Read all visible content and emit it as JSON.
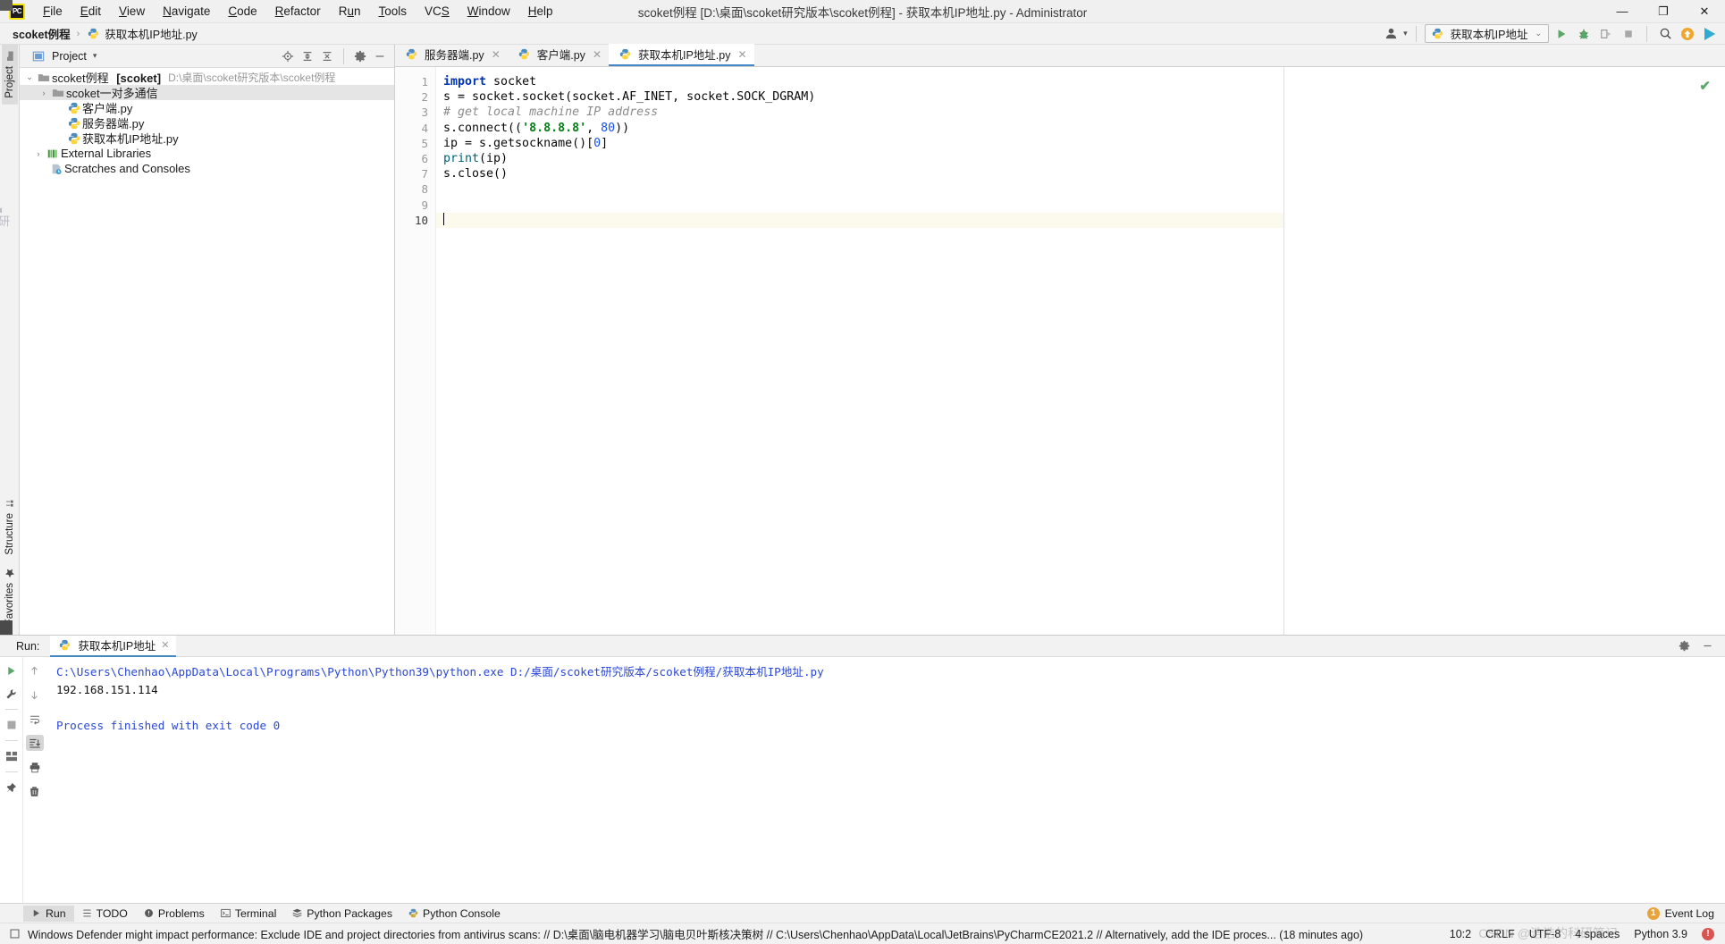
{
  "window": {
    "title": "scoket例程 [D:\\桌面\\scoket研究版本\\scoket例程] - 获取本机IP地址.py - Administrator",
    "minimize": "—",
    "maximize": "❐",
    "close": "✕"
  },
  "menu": [
    {
      "label": "File"
    },
    {
      "label": "Edit"
    },
    {
      "label": "View"
    },
    {
      "label": "Navigate"
    },
    {
      "label": "Code"
    },
    {
      "label": "Refactor"
    },
    {
      "label": "Run"
    },
    {
      "label": "Tools"
    },
    {
      "label": "VCS"
    },
    {
      "label": "Window"
    },
    {
      "label": "Help"
    }
  ],
  "breadcrumb": {
    "project": "scoket例程",
    "separator": "›",
    "file": "获取本机IP地址.py"
  },
  "toolbar": {
    "run_config": "获取本机IP地址",
    "chevron": "⌄",
    "account_caret": "▾"
  },
  "project_panel": {
    "title": "Project",
    "title_caret": "▾",
    "tree": [
      {
        "indent": 0,
        "arrow": "⌄",
        "label": "scoket例程",
        "module": "[scoket]",
        "path": "D:\\桌面\\scoket研究版本\\scoket例程",
        "icon": "folder-icon",
        "selected": false
      },
      {
        "indent": 1,
        "arrow": "›",
        "label": "scoket一对多通信",
        "module": "",
        "path": "",
        "icon": "folder-icon",
        "selected": true
      },
      {
        "indent": 2,
        "arrow": "",
        "label": "客户端.py",
        "module": "",
        "path": "",
        "icon": "python-file-icon",
        "selected": false
      },
      {
        "indent": 2,
        "arrow": "",
        "label": "服务器端.py",
        "module": "",
        "path": "",
        "icon": "python-file-icon",
        "selected": false
      },
      {
        "indent": 2,
        "arrow": "",
        "label": "获取本机IP地址.py",
        "module": "",
        "path": "",
        "icon": "python-file-icon",
        "selected": false
      },
      {
        "indent": 0,
        "arrow": "›",
        "label": "External Libraries",
        "module": "",
        "path": "",
        "icon": "libraries-icon",
        "selected": false
      },
      {
        "indent": 0,
        "arrow": "",
        "label": "Scratches and Consoles",
        "module": "",
        "path": "",
        "icon": "scratches-icon",
        "selected": false
      }
    ]
  },
  "left_strip": {
    "project_tab": "Project",
    "structure_tab": "Structure",
    "favorites_tab": "Favorites"
  },
  "editor": {
    "tabs": [
      {
        "label": "服务器端.py",
        "active": false,
        "close": "✕"
      },
      {
        "label": "客户端.py",
        "active": false,
        "close": "✕"
      },
      {
        "label": "获取本机IP地址.py",
        "active": true,
        "close": "✕"
      }
    ],
    "line_numbers": [
      "1",
      "2",
      "3",
      "4",
      "5",
      "6",
      "7",
      "8",
      "9",
      "10"
    ],
    "current_line": 10,
    "code": [
      [
        {
          "t": "import",
          "c": "kw"
        },
        {
          "t": " socket",
          "c": "pln"
        }
      ],
      [
        {
          "t": "s = socket.socket(socket.AF_INET, socket.SOCK_DGRAM)",
          "c": "pln"
        }
      ],
      [
        {
          "t": "# get local machine IP address",
          "c": "cmt"
        }
      ],
      [
        {
          "t": "s.connect((",
          "c": "pln"
        },
        {
          "t": "'8.8.8.8'",
          "c": "str"
        },
        {
          "t": ", ",
          "c": "pln"
        },
        {
          "t": "80",
          "c": "num"
        },
        {
          "t": "))",
          "c": "pln"
        }
      ],
      [
        {
          "t": "ip = s.getsockname()[",
          "c": "pln"
        },
        {
          "t": "0",
          "c": "num"
        },
        {
          "t": "]",
          "c": "pln"
        }
      ],
      [
        {
          "t": "print",
          "c": "fn"
        },
        {
          "t": "(ip)",
          "c": "pln"
        }
      ],
      [
        {
          "t": "s.close()",
          "c": "pln"
        }
      ],
      [],
      [],
      []
    ]
  },
  "run_panel": {
    "label": "Run:",
    "tab": "获取本机IP地址",
    "tab_close": "✕",
    "lines": [
      {
        "text": "C:\\Users\\Chenhao\\AppData\\Local\\Programs\\Python\\Python39\\python.exe D:/桌面/scoket研究版本/scoket例程/获取本机IP地址.py",
        "cls": "c-cmd"
      },
      {
        "text": "192.168.151.114",
        "cls": "c-out"
      },
      {
        "text": "",
        "cls": "c-out"
      },
      {
        "text": "Process finished with exit code 0",
        "cls": "c-fin"
      }
    ]
  },
  "bottom_tabs": [
    {
      "label": "Run",
      "icon": "play-icon",
      "active": true
    },
    {
      "label": "TODO",
      "icon": "todo-icon",
      "active": false
    },
    {
      "label": "Problems",
      "icon": "problems-icon",
      "active": false
    },
    {
      "label": "Terminal",
      "icon": "terminal-icon",
      "active": false
    },
    {
      "label": "Python Packages",
      "icon": "packages-icon",
      "active": false
    },
    {
      "label": "Python Console",
      "icon": "python-console-icon",
      "active": false
    }
  ],
  "event_log": {
    "label": "Event Log",
    "count": "1"
  },
  "statusbar": {
    "message": "Windows Defender might impact performance: Exclude IDE and project directories from antivirus scans: // D:\\桌面\\脑电机器学习\\脑电贝叶斯核决策树 // C:\\Users\\Chenhao\\AppData\\Local\\JetBrains\\PyCharmCE2021.2 // Alternatively, add the IDE proces... (18 minutes ago)",
    "position": "10:2",
    "line_sep": "CRLF",
    "encoding": "UTF-8",
    "indent": "4 spaces",
    "interpreter": "Python 3.9"
  },
  "watermark": "CSDN @浩浩的科研笔记",
  "colors": {
    "accent": "#4387c7",
    "keyword": "#0033b3",
    "string": "#067d17",
    "number": "#1750eb",
    "comment": "#8c8c8c",
    "console_blue": "#2a47d6",
    "success_green": "#59a869"
  }
}
